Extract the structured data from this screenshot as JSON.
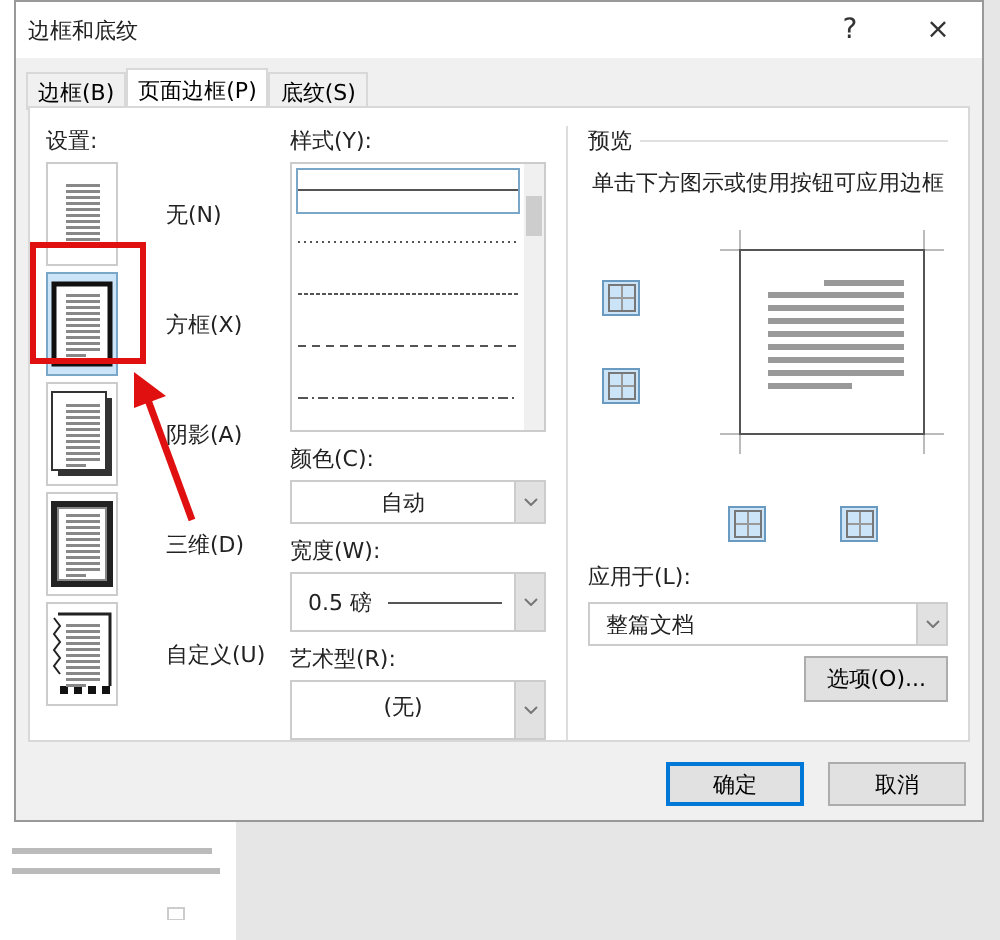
{
  "window": {
    "title": "边框和底纹",
    "help": "?",
    "close": "×"
  },
  "tabs": [
    {
      "label": "边框(B)",
      "selected": false
    },
    {
      "label": "页面边框(P)",
      "selected": true
    },
    {
      "label": "底纹(S)",
      "selected": false
    }
  ],
  "settings": {
    "label": "设置:",
    "items": [
      {
        "kind": "none",
        "label": "无(N)",
        "selected": false
      },
      {
        "kind": "box",
        "label": "方框(X)",
        "selected": true
      },
      {
        "kind": "shadow",
        "label": "阴影(A)",
        "selected": false
      },
      {
        "kind": "threed",
        "label": "三维(D)",
        "selected": false
      },
      {
        "kind": "custom",
        "label": "自定义(U)",
        "selected": false
      }
    ]
  },
  "style": {
    "label": "样式(Y):",
    "lines": [
      {
        "kind": "solid",
        "selected": true
      },
      {
        "kind": "dotted",
        "selected": false
      },
      {
        "kind": "fine-dash",
        "selected": false
      },
      {
        "kind": "dashed",
        "selected": false
      },
      {
        "kind": "dash-dot",
        "selected": false
      }
    ]
  },
  "color": {
    "label": "颜色(C):",
    "value": "自动"
  },
  "width": {
    "label": "宽度(W):",
    "value": "0.5 磅"
  },
  "art": {
    "label": "艺术型(R):",
    "value": "(无)"
  },
  "preview": {
    "label": "预览",
    "hint": "单击下方图示或使用按钮可应用边框"
  },
  "apply_to": {
    "label": "应用于(L):",
    "value": "整篇文档"
  },
  "options_button": "选项(O)...",
  "buttons": [
    {
      "label": "确定",
      "default": true
    },
    {
      "label": "取消",
      "default": false
    }
  ]
}
